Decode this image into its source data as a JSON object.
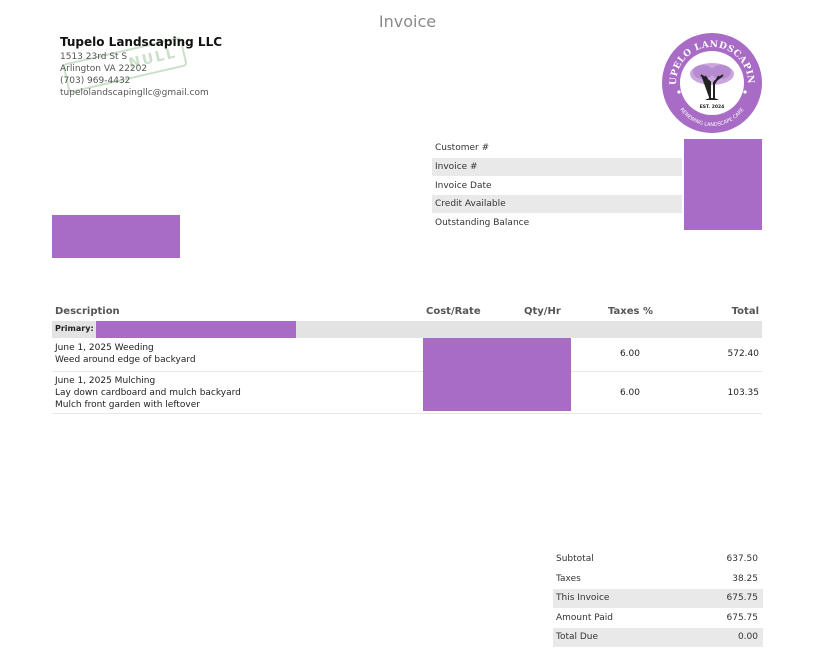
{
  "document": {
    "title": "Invoice"
  },
  "company": {
    "name": "Tupelo Landscaping LLC",
    "address1": "1513 23rd St S",
    "address2": "Arlington VA 22202",
    "phone": "(703) 969-4432",
    "email": "tupelolandscapingllc@gmail.com",
    "stamp_text": "NULL"
  },
  "logo": {
    "arc_top": "TUPELO LANDSCAPING",
    "arc_bottom": "RENEWING LANDSCAPE CARE",
    "est": "EST. 2024",
    "color": "#a96cc6"
  },
  "meta": {
    "labels": [
      "Customer #",
      "Invoice #",
      "Invoice Date",
      "Credit Available",
      "Outstanding Balance"
    ]
  },
  "table": {
    "headers": {
      "description": "Description",
      "cost_rate": "Cost/Rate",
      "qty_hr": "Qty/Hr",
      "taxes": "Taxes %",
      "total": "Total"
    },
    "primary_label": "Primary:",
    "items": [
      {
        "lines": [
          "June 1, 2025 Weeding",
          "Weed around edge of backyard"
        ],
        "tax": "6.00",
        "total": "572.40"
      },
      {
        "lines": [
          "June 1, 2025 Mulching",
          "Lay down cardboard and mulch backyard",
          "Mulch front garden with leftover"
        ],
        "tax": "6.00",
        "total": "103.35"
      }
    ]
  },
  "summary": {
    "subtotal_label": "Subtotal",
    "subtotal": "637.50",
    "taxes_label": "Taxes",
    "taxes": "38.25",
    "this_invoice_label": "This Invoice",
    "this_invoice": "675.75",
    "amount_paid_label": "Amount Paid",
    "amount_paid": "675.75",
    "total_due_label": "Total Due",
    "total_due": "0.00"
  },
  "colors": {
    "redaction": "#a96cc6",
    "shade": "#e9e9e9"
  }
}
